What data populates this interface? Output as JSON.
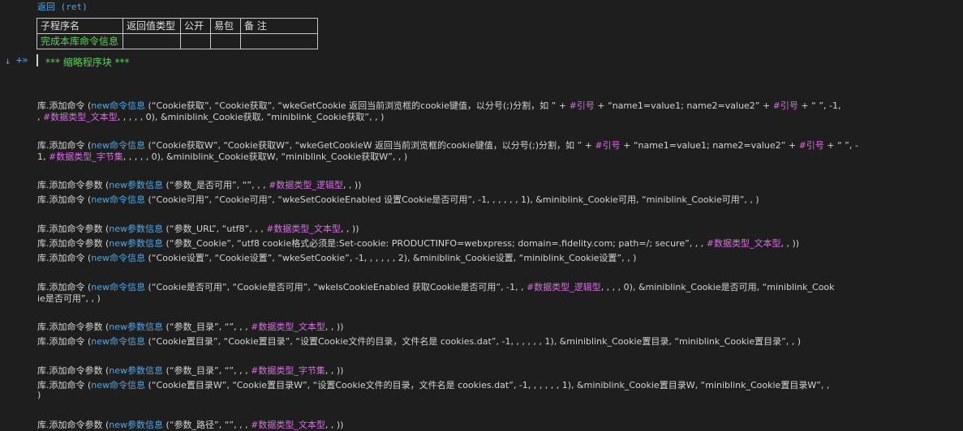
{
  "return_line": "返回 (ret)",
  "table": {
    "headers": [
      "子程序名",
      "返回值类型",
      "公开",
      "易包",
      "备 注"
    ],
    "row": [
      "完成本库命令信息",
      "",
      "",
      "",
      ""
    ]
  },
  "collapsed_label": "*** 缩略程序块 ***",
  "lines": [
    {
      "text": "库.添加命令 (new命令信息 (“Cookie获取”, “Cookie获取”, “wkeGetCookie 返回当前浏览框的cookie键值，以分号(;)分割，如 ” + #引号 + “name1=value1; name2=value2” + #引号 + “  ”, -1,"
    },
    {
      "text": ", #数据类型_文本型, , , , , 0), &miniblink_Cookie获取, “miniblink_Cookie获取”, , )"
    },
    {
      "text": "库.添加命令 (new命令信息 (“Cookie获取W”, “Cookie获取W”, “wkeGetCookieW 返回当前浏览框的cookie键值，以分号(;)分割，如 ” + #引号 + “name1=value1; name2=value2” + #引号 + “ ”, -"
    },
    {
      "text": "1, #数据类型_字节集, , , , , 0), &miniblink_Cookie获取W, “miniblink_Cookie获取W”, , )"
    },
    {
      "text": "库.添加命令参数 (new参数信息 (“参数_是否可用”, “”, , , #数据类型_逻辑型, , ))"
    },
    {
      "text": "库.添加命令 (new命令信息 (“Cookie可用”, “Cookie可用”, “wkeSetCookieEnabled 设置Cookie是否可用”, -1, , , , , , 1), &miniblink_Cookie可用, “miniblink_Cookie可用”, , )"
    },
    {
      "text": "库.添加命令参数 (new参数信息 (“参数_URL”, “utf8”, , , #数据类型_文本型, , ))"
    },
    {
      "text": "库.添加命令参数 (new参数信息 (“参数_Cookie”, “utf8 cookie格式必须是:Set-cookie: PRODUCTINFO=webxpress; domain=.fidelity.com; path=/; secure”, , , #数据类型_文本型, , ))"
    },
    {
      "text": "库.添加命令 (new命令信息 (“Cookie设置”, “Cookie设置”, “wkeSetCookie”, -1, , , , , , 2), &miniblink_Cookie设置, “miniblink_Cookie设置”, , )"
    },
    {
      "text": "库.添加命令 (new命令信息 (“Cookie是否可用”, “Cookie是否可用”, “wkeIsCookieEnabled 获取Cookie是否可用”, -1, , #数据类型_逻辑型, , , , 0), &miniblink_Cookie是否可用, “miniblink_Cook"
    },
    {
      "text": "ie是否可用”, , )"
    },
    {
      "text": "库.添加命令参数 (new参数信息 (“参数_目录”, “”, , , #数据类型_文本型, , ))"
    },
    {
      "text": "库.添加命令 (new命令信息 (“Cookie置目录”, “Cookie置目录”, “设置Cookie文件的目录，文件名是 cookies.dat”, -1, , , , , , 1), &miniblink_Cookie置目录, “miniblink_Cookie置目录”, , )"
    },
    {
      "text": "库.添加命令参数 (new参数信息 (“参数_目录”, “”, , , #数据类型_字节集, , ))"
    },
    {
      "text": "库.添加命令 (new命令信息 (“Cookie置目录W”, “Cookie置目录W”, “设置Cookie文件的目录，文件名是 cookies.dat”, -1, , , , , , 1), &miniblink_Cookie置目录W, “miniblink_Cookie置目录W”, ,"
    },
    {
      "text": ")"
    },
    {
      "text": "库.添加命令参数 (new参数信息 (“参数_路径”, “”, , , #数据类型_文本型, , ))"
    }
  ]
}
